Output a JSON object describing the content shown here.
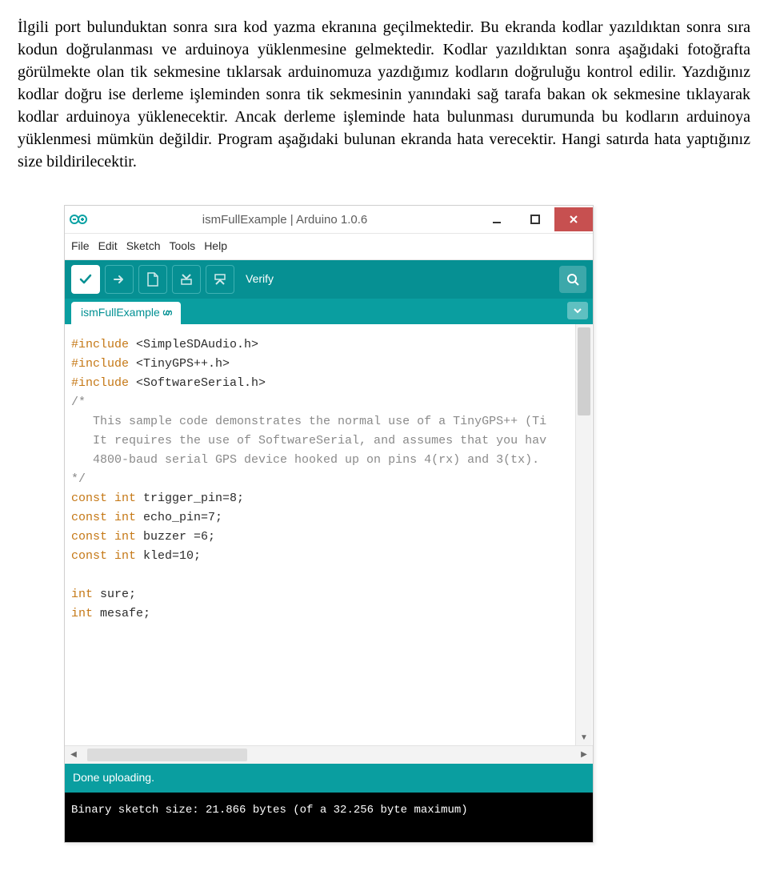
{
  "paragraph": "İlgili port bulunduktan sonra sıra kod yazma ekranına geçilmektedir. Bu ekranda kodlar yazıldıktan sonra sıra kodun doğrulanması ve arduinoya yüklenmesine gelmektedir. Kodlar yazıldıktan sonra aşağıdaki fotoğrafta görülmekte olan tik sekmesine tıklarsak arduinomuza yazdığımız kodların doğruluğu kontrol edilir. Yazdığınız kodlar doğru ise derleme işleminden sonra tik sekmesinin yanındaki sağ tarafa bakan ok sekmesine tıklayarak kodlar arduinoya yüklenecektir. Ancak derleme işleminde hata bulunması durumunda bu kodların arduinoya yüklenmesi mümkün değildir. Program aşağıdaki bulunan ekranda hata verecektir. Hangi satırda hata yaptığınız size bildirilecektir.",
  "window": {
    "title": "ismFullExample | Arduino 1.0.6"
  },
  "menu": {
    "file": "File",
    "edit": "Edit",
    "sketch": "Sketch",
    "tools": "Tools",
    "help": "Help"
  },
  "toolbar": {
    "verify": "Verify"
  },
  "tab": {
    "name": "ismFullExample",
    "chevron": "§"
  },
  "code": {
    "l1a": "#include",
    "l1b": " <SimpleSDAudio.h>",
    "l2a": "#include",
    "l2b": " <TinyGPS++.h>",
    "l3a": "#include",
    "l3b": " <SoftwareSerial.h>",
    "c1": "/*",
    "c2": "   This sample code demonstrates the normal use of a TinyGPS++ (Ti",
    "c3": "   It requires the use of SoftwareSerial, and assumes that you hav",
    "c4": "   4800-baud serial GPS device hooked up on pins 4(rx) and 3(tx).",
    "c5": "*/",
    "d1a": "const",
    "d1b": " int",
    "d1c": " trigger_pin=8;",
    "d2a": "const",
    "d2b": " int",
    "d2c": " echo_pin=7;",
    "d3a": "const",
    "d3b": " int",
    "d3c": " buzzer =6;",
    "d4a": "const",
    "d4b": " int",
    "d4c": " kled=10;",
    "e1a": "int",
    "e1b": " sure;",
    "e2a": "int",
    "e2b": " mesafe;"
  },
  "status": "Done uploading.",
  "console": "Binary sketch size: 21.866 bytes (of a 32.256 byte maximum)"
}
